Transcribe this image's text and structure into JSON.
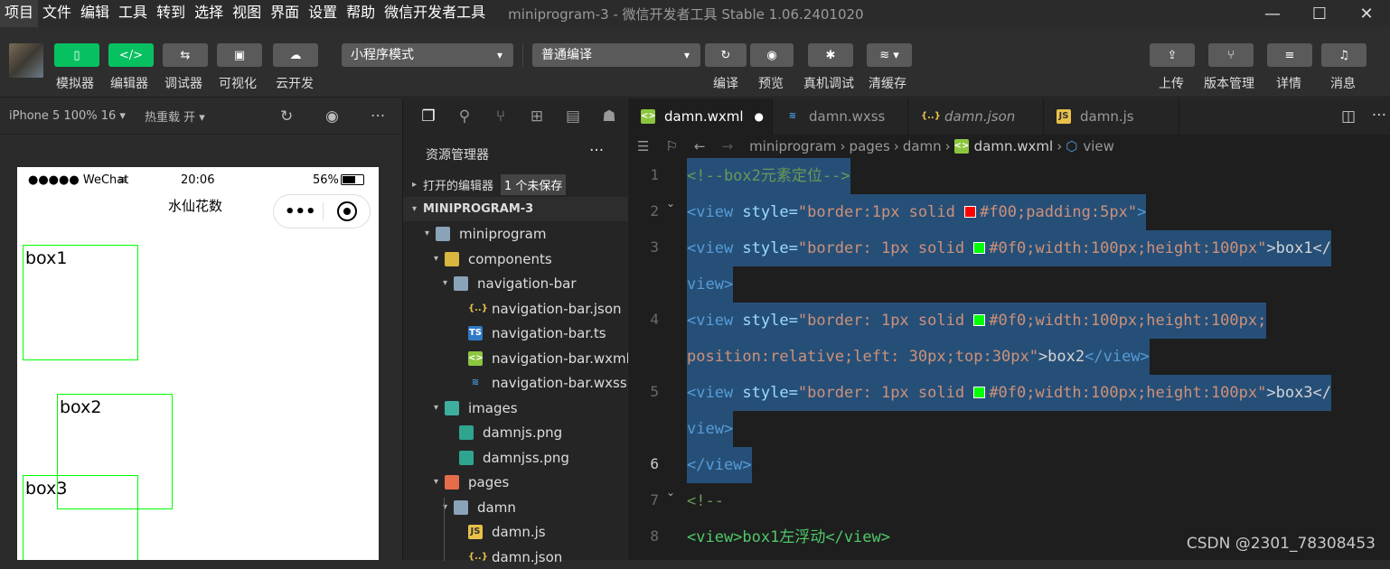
{
  "menubar": {
    "items": [
      "项目",
      "文件",
      "编辑",
      "工具",
      "转到",
      "选择",
      "视图",
      "界面",
      "设置",
      "帮助",
      "微信开发者工具"
    ],
    "title": "miniprogram-3 - 微信开发者工具 Stable 1.06.2401020"
  },
  "toolbar": {
    "simulator": "模拟器",
    "editor": "编辑器",
    "debugger": "调试器",
    "visual": "可视化",
    "cloud": "云开发",
    "mode": "小程序模式",
    "compile_mode": "普通编译",
    "compile": "编译",
    "preview": "预览",
    "remote_debug": "真机调试",
    "clear_cache": "清缓存",
    "upload": "上传",
    "version": "版本管理",
    "details": "详情",
    "messages": "消息"
  },
  "simulator": {
    "device": "iPhone 5 100% 16 ▾",
    "hot_reload": "热重载 开 ▾",
    "status_carrier": "●●●●● WeChat",
    "status_time": "20:06",
    "status_battery": "56%",
    "nav_title": "水仙花数",
    "boxes": [
      "box1",
      "box2",
      "box3"
    ]
  },
  "explorer": {
    "title": "资源管理器",
    "open_editors": "打开的编辑器",
    "unsaved": "1 个未保存",
    "project": "MINIPROGRAM-3",
    "tree": [
      {
        "name": "miniprogram",
        "type": "folder"
      },
      {
        "name": "components",
        "type": "folder"
      },
      {
        "name": "navigation-bar",
        "type": "folder"
      },
      {
        "name": "navigation-bar.json",
        "type": "json"
      },
      {
        "name": "navigation-bar.ts",
        "type": "ts"
      },
      {
        "name": "navigation-bar.wxml",
        "type": "wxml"
      },
      {
        "name": "navigation-bar.wxss",
        "type": "wxss"
      },
      {
        "name": "images",
        "type": "folder"
      },
      {
        "name": "damnjs.png",
        "type": "png"
      },
      {
        "name": "damnjss.png",
        "type": "png"
      },
      {
        "name": "pages",
        "type": "folder"
      },
      {
        "name": "damn",
        "type": "folder"
      },
      {
        "name": "damn.js",
        "type": "js"
      },
      {
        "name": "damn.json",
        "type": "json"
      }
    ]
  },
  "editor": {
    "tabs": [
      "damn.wxml",
      "damn.wxss",
      "damn.json",
      "damn.js"
    ],
    "breadcrumb": [
      "miniprogram",
      "pages",
      "damn",
      "damn.wxml",
      "view"
    ],
    "line_numbers": [
      "1",
      "2",
      "3",
      "4",
      "5",
      "6",
      "7",
      "8"
    ],
    "lines": {
      "l1": "<!--box2元素定位-->",
      "l2a": "<view ",
      "l2b": "style=",
      "l2c": "\"border:1px solid ",
      "l2d": "#f00;padding:5px\"",
      "l2e": ">",
      "l3a": "<view ",
      "l3b": "style=",
      "l3c": "\"border: 1px solid ",
      "l3d": "#0f0;width:100px;height:100px\"",
      "l3e": ">box1</",
      "l3f": "view>",
      "l4a": "<view ",
      "l4b": "style=",
      "l4c": "\"border: 1px solid ",
      "l4d": "#0f0;width:100px;height:100px;",
      "l4e": "position:relative;left: 30px;top:30px\"",
      "l4f": ">box2",
      "l4g": "</view>",
      "l5a": "<view ",
      "l5b": "style=",
      "l5c": "\"border: 1px solid ",
      "l5d": "#0f0;width:100px;height:100px\"",
      "l5e": ">box3</",
      "l5f": "view>",
      "l6": "</view>",
      "l7": "<!--",
      "l8": "<view>box1左浮动</view>"
    }
  },
  "watermark": "CSDN @2301_78308453",
  "colors": {
    "accent": "#07c160",
    "box_border": "#00ff00",
    "swatch_red": "#ff0000"
  }
}
